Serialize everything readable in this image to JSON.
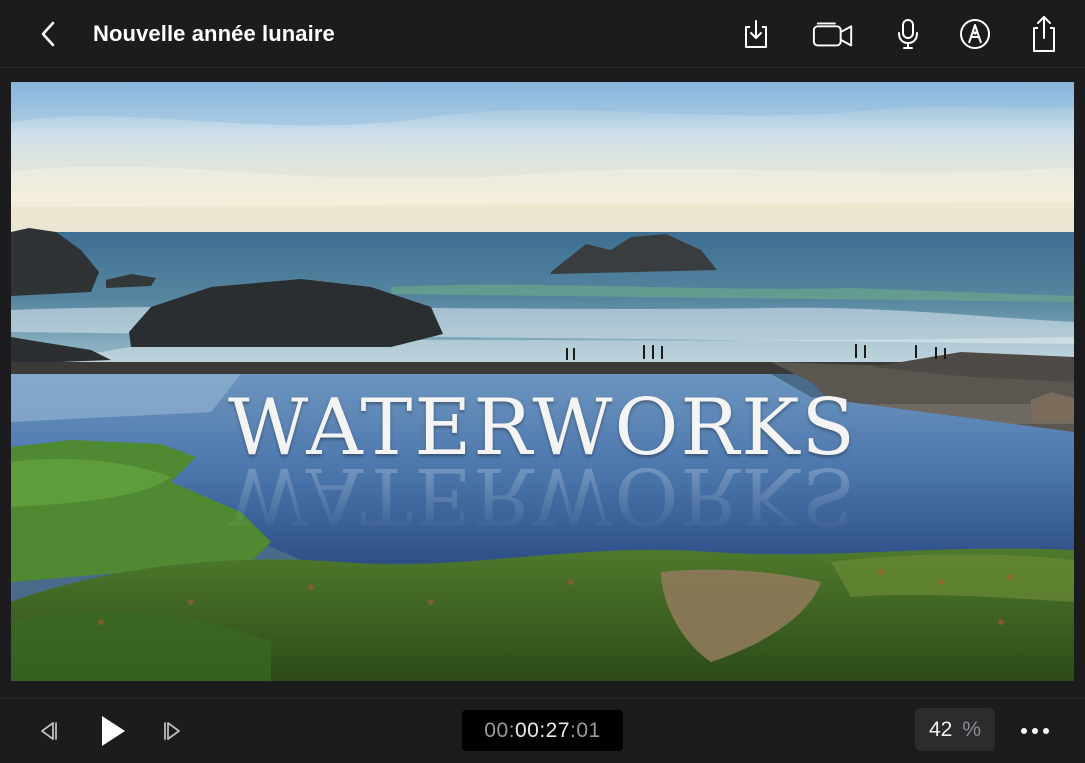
{
  "header": {
    "title": "Nouvelle année lunaire",
    "back_icon": "chevron-left-icon",
    "actions": [
      {
        "name": "import",
        "icon": "import-download-icon"
      },
      {
        "name": "camera",
        "icon": "video-camera-icon"
      },
      {
        "name": "voiceover",
        "icon": "microphone-icon"
      },
      {
        "name": "annotate",
        "icon": "pen-tip-icon"
      },
      {
        "name": "share",
        "icon": "share-icon"
      }
    ]
  },
  "viewer": {
    "title_text": "WATERWORKS"
  },
  "transport": {
    "timecode": {
      "prefix": "00:",
      "main": "00:27",
      "suffix": ":01"
    },
    "zoom_value": "42",
    "zoom_unit": "%",
    "previous_icon": "step-back-icon",
    "play_icon": "play-icon",
    "next_icon": "step-forward-icon",
    "more_icon": "ellipsis-icon"
  },
  "colors": {
    "background": "#1c1c1e",
    "accent": "#ffffff",
    "timecode_bg": "#000000"
  }
}
